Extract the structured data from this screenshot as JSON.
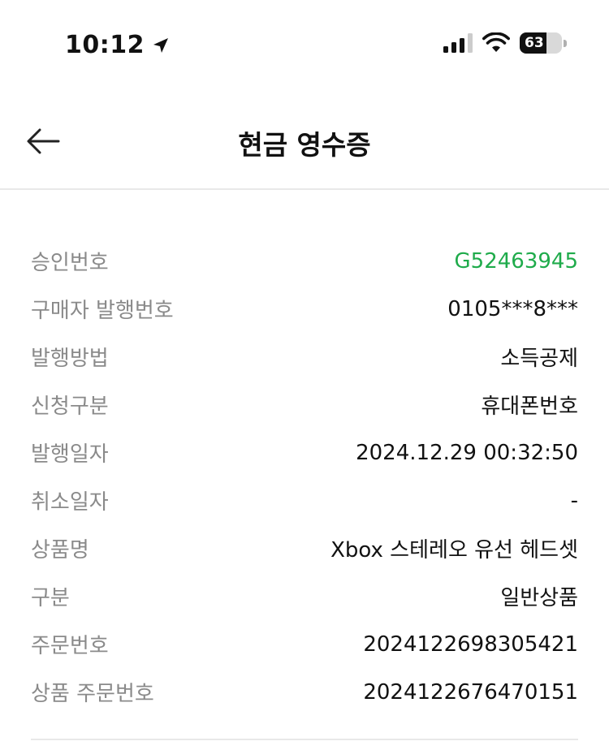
{
  "status_bar": {
    "time": "10:12",
    "battery_percent": 63,
    "battery_label": "63"
  },
  "header": {
    "title": "현금 영수증",
    "back_icon": "arrow-left-icon"
  },
  "colors": {
    "accent": "#1fab4b",
    "label": "#8a8a8a",
    "text": "#111111",
    "divider": "#e8e8e8"
  },
  "receipt": {
    "rows": [
      {
        "label": "승인번호",
        "value": "G52463945",
        "accent": true
      },
      {
        "label": "구매자 발행번호",
        "value": "0105***8***"
      },
      {
        "label": "발행방법",
        "value": "소득공제"
      },
      {
        "label": "신청구분",
        "value": "휴대폰번호"
      },
      {
        "label": "발행일자",
        "value": "2024.12.29 00:32:50"
      },
      {
        "label": "취소일자",
        "value": "-"
      },
      {
        "label": "상품명",
        "value": "Xbox 스테레오 유선 헤드셋"
      },
      {
        "label": "구분",
        "value": "일반상품"
      },
      {
        "label": "주문번호",
        "value": "2024122698305421"
      },
      {
        "label": "상품 주문번호",
        "value": "2024122676470151"
      }
    ]
  }
}
